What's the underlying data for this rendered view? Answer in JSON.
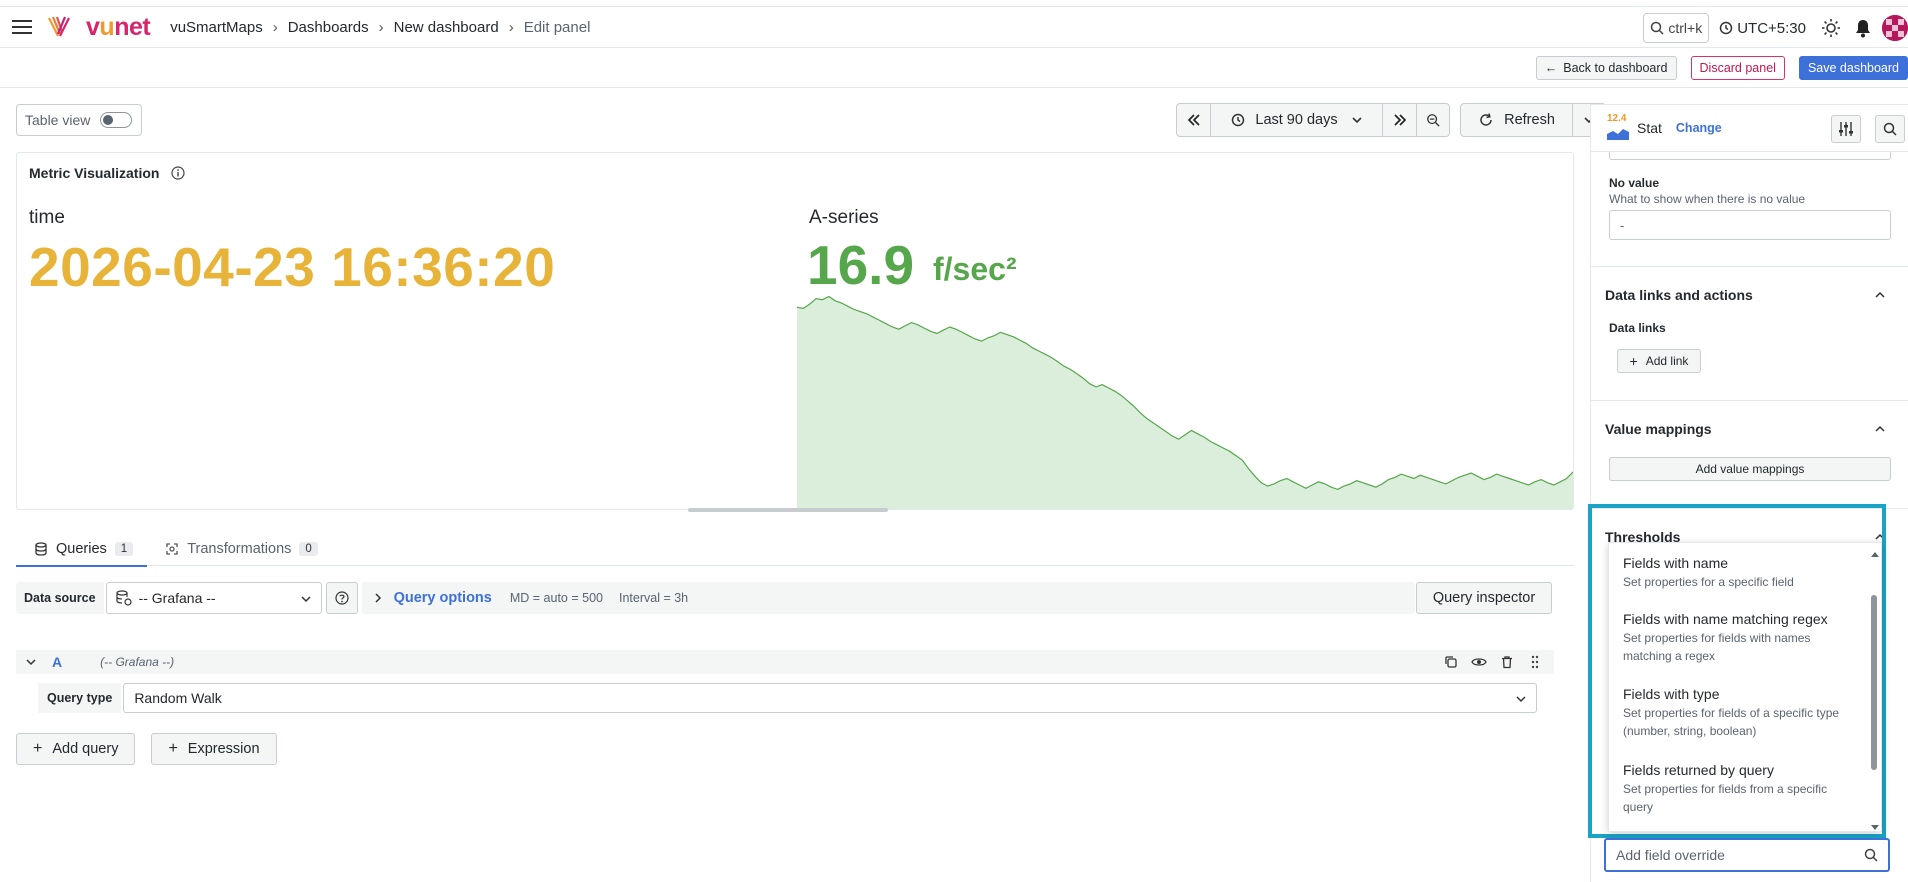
{
  "topbar": {
    "brand_prefix": "v",
    "brand_u": "u",
    "brand_suffix": "net",
    "breadcrumbs": [
      "vuSmartMaps",
      "Dashboards",
      "New dashboard",
      "Edit panel"
    ],
    "search_shortcut": "ctrl+k",
    "timezone": "UTC+5:30"
  },
  "actions": {
    "back": "Back to dashboard",
    "discard": "Discard panel",
    "save": "Save dashboard"
  },
  "panel": {
    "table_view_label": "Table view",
    "time_range": "Last 90 days",
    "refresh_label": "Refresh",
    "title": "Metric Visualization",
    "stat_time_label": "time",
    "stat_time_value": "2026-04-23 16:36:20",
    "stat_series_label": "A-series",
    "stat_series_value": "16.9",
    "stat_series_unit": "f/sec²"
  },
  "chart_data": {
    "type": "area",
    "series": [
      {
        "values": [
          18.5,
          18.4,
          18.8,
          19.3,
          19.2,
          19.5,
          19.1,
          18.9,
          18.6,
          18.3,
          18.1,
          17.9,
          17.6,
          17.3,
          17.0,
          16.7,
          16.5,
          16.8,
          17.1,
          16.9,
          16.6,
          16.3,
          16.1,
          16.4,
          16.7,
          16.5,
          16.2,
          15.9,
          15.6,
          15.4,
          15.7,
          15.9,
          16.2,
          16.0,
          15.8,
          15.5,
          15.2,
          14.8,
          14.5,
          14.2,
          13.9,
          13.5,
          13.1,
          12.8,
          12.4,
          12.0,
          11.5,
          11.2,
          11.4,
          11.1,
          10.8,
          10.4,
          9.9,
          9.4,
          8.8,
          8.3,
          7.9,
          7.5,
          7.1,
          6.7,
          6.4,
          6.8,
          7.2,
          6.9,
          6.6,
          6.2,
          5.9,
          5.6,
          5.3,
          4.9,
          4.5,
          3.7,
          3.0,
          2.4,
          2.1,
          2.3,
          2.6,
          2.8,
          2.5,
          2.2,
          1.9,
          2.2,
          2.5,
          2.3,
          2.0,
          1.8,
          2.1,
          2.3,
          2.6,
          2.4,
          2.2,
          2.0,
          2.3,
          2.7,
          2.9,
          3.2,
          3.0,
          2.8,
          3.1,
          2.9,
          2.7,
          2.5,
          2.3,
          2.6,
          2.9,
          3.1,
          3.3,
          3.0,
          2.7,
          2.9,
          3.2,
          3.0,
          2.8,
          2.6,
          2.4,
          2.2,
          2.5,
          2.7,
          2.4,
          2.2,
          2.5,
          2.8,
          3.4
        ]
      }
    ]
  },
  "tabs": [
    {
      "label": "Queries",
      "count": "1"
    },
    {
      "label": "Transformations",
      "count": "0"
    }
  ],
  "query": {
    "datasource_label": "Data source",
    "datasource_value": "-- Grafana --",
    "options_label": "Query options",
    "md_meta": "MD = auto = 500",
    "interval_meta": "Interval = 3h",
    "inspector_label": "Query inspector",
    "row_letter": "A",
    "row_source": "(-- Grafana --)",
    "type_label": "Query type",
    "type_value": "Random Walk",
    "add_query": "Add query",
    "expression": "Expression"
  },
  "sidebar": {
    "vis_icon_number": "12.4",
    "vis_name": "Stat",
    "change_label": "Change",
    "no_value_title": "No value",
    "no_value_desc": "What to show when there is no value",
    "no_value_input": "-",
    "data_links_title": "Data links and actions",
    "data_links_sub": "Data links",
    "add_link": "Add link",
    "value_mappings_title": "Value mappings",
    "add_value_mappings": "Add value mappings",
    "thresholds_title": "Thresholds",
    "override_placeholder": "Add field override"
  },
  "dropdown": {
    "items": [
      {
        "title": "Fields with name",
        "desc": "Set properties for a specific field"
      },
      {
        "title": "Fields with name matching regex",
        "desc": "Set properties for fields with names matching a regex"
      },
      {
        "title": "Fields with type",
        "desc": "Set properties for fields of a specific type (number, string, boolean)"
      },
      {
        "title": "Fields returned by query",
        "desc": "Set properties for fields from a specific query"
      }
    ]
  },
  "colors": {
    "accent": "#3d71d9",
    "stat_time": "#e8b339",
    "stat_series": "#56a64b",
    "highlight": "#1aa3c4",
    "brand": "#d6256a"
  }
}
